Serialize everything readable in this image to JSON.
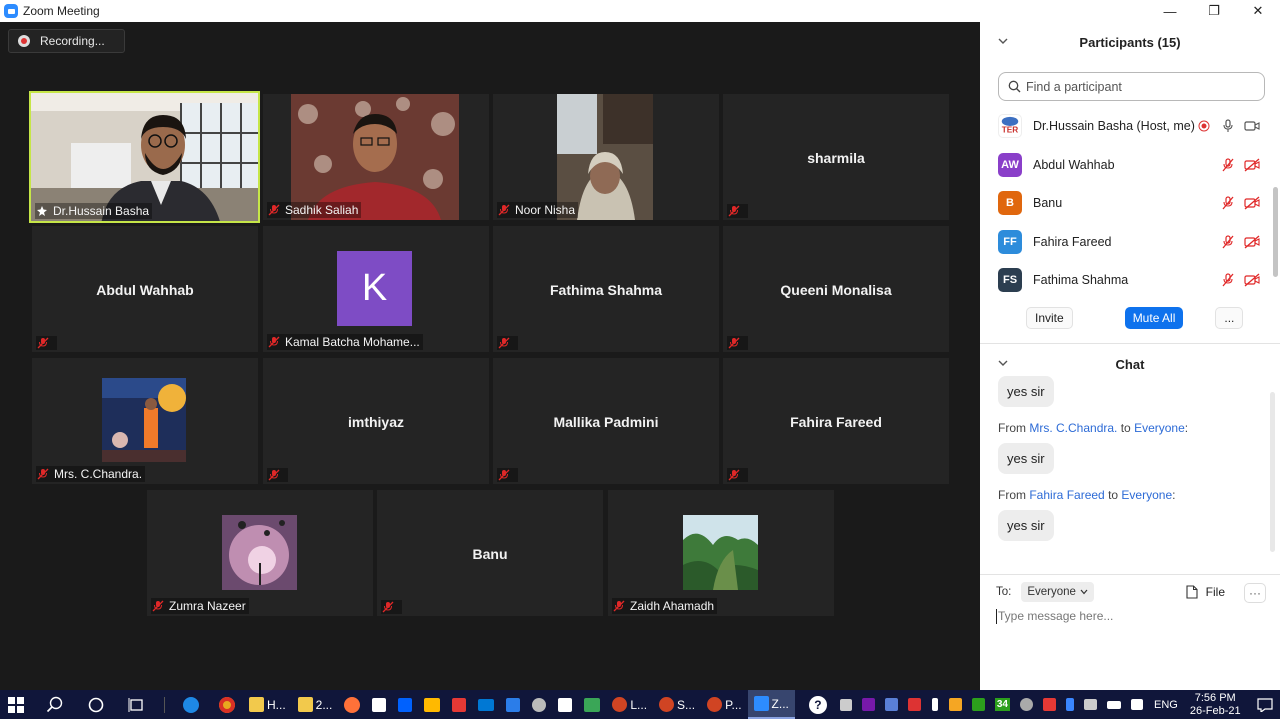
{
  "window": {
    "title": "Zoom Meeting"
  },
  "recording": {
    "label": "Recording..."
  },
  "tiles": [
    {
      "name": "Dr.Hussain Basha",
      "display": "video",
      "host": true
    },
    {
      "name": "Sadhik Saliah",
      "display": "video"
    },
    {
      "name": "Noor Nisha",
      "display": "video"
    },
    {
      "name": "sharmila",
      "display": "name"
    },
    {
      "name": "Abdul Wahhab",
      "display": "name"
    },
    {
      "name": "Kamal Batcha Mohame...",
      "display": "avatar",
      "avatar_letter": "K",
      "avatar_color": "#7e4cc5"
    },
    {
      "name": "Fathima Shahma",
      "display": "name"
    },
    {
      "name": "Queeni Monalisa",
      "display": "name"
    },
    {
      "name": "Mrs. C.Chandra.",
      "display": "photo"
    },
    {
      "name": "imthiyaz",
      "display": "name"
    },
    {
      "name": "Mallika Padmini",
      "display": "name"
    },
    {
      "name": "Fahira Fareed",
      "display": "name"
    },
    {
      "name": "Zumra Nazeer",
      "display": "photo"
    },
    {
      "name": "Banu",
      "display": "name"
    },
    {
      "name": "Zaidh Ahamadh",
      "display": "photo"
    }
  ],
  "participants": {
    "title": "Participants (15)",
    "search_placeholder": "Find a participant",
    "list": [
      {
        "name": "Dr.Hussain Basha (Host, me)",
        "initials": "TER",
        "color": "#c9302c"
      },
      {
        "name": "Abdul Wahhab",
        "initials": "AW",
        "color": "#8a3fc9"
      },
      {
        "name": "Banu",
        "initials": "B",
        "color": "#e0670e"
      },
      {
        "name": "Fahira Fareed",
        "initials": "FF",
        "color": "#2d8cdb"
      },
      {
        "name": "Fathima Shahma",
        "initials": "FS",
        "color": "#2c3e50"
      }
    ],
    "invite_label": "Invite",
    "mute_all_label": "Mute All",
    "more_label": "..."
  },
  "chat": {
    "title": "Chat",
    "from_word": "From",
    "to_word": "to",
    "messages": [
      {
        "text": "yes sir"
      },
      {
        "from": "Mrs. C.Chandra.",
        "to": "Everyone",
        "text": "yes sir"
      },
      {
        "from": "Fahira Fareed",
        "to": "Everyone",
        "text": "yes sir"
      }
    ],
    "to_label": "To:",
    "recipient": "Everyone",
    "file_label": "File",
    "more_label": "···",
    "input_placeholder": "Type message here..."
  },
  "taskbar": {
    "apps": [
      {
        "label": "H...",
        "color": "#f2c94c"
      },
      {
        "label": "2...",
        "color": "#f2c94c"
      },
      {
        "label": "L...",
        "color": "#d04423"
      },
      {
        "label": "S...",
        "color": "#d04423"
      },
      {
        "label": "P...",
        "color": "#d04423"
      },
      {
        "label": "Z...",
        "color": "#2d8cff"
      }
    ],
    "tray_badge": "34",
    "language": "ENG",
    "time": "7:56 PM",
    "date": "26-Feb-21"
  }
}
